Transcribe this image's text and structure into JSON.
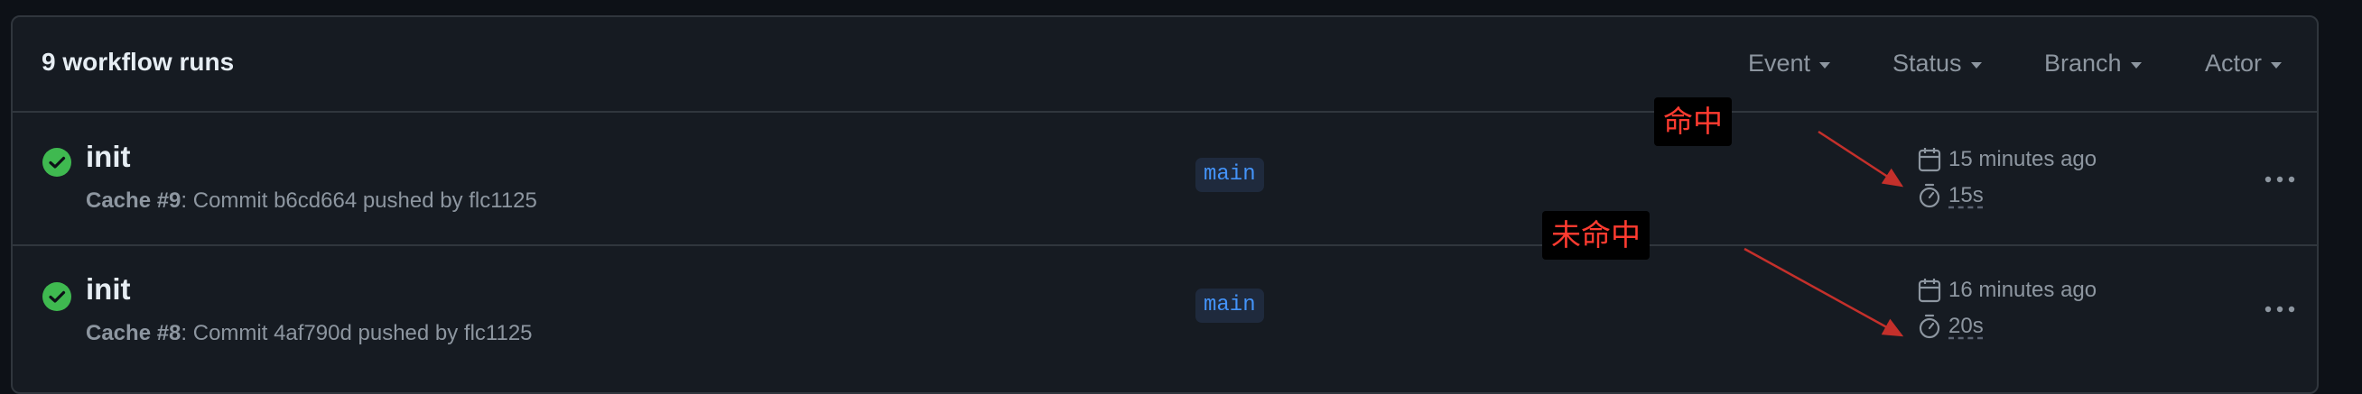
{
  "header": {
    "title": "9 workflow runs",
    "filters": [
      "Event",
      "Status",
      "Branch",
      "Actor"
    ]
  },
  "runs": [
    {
      "title": "init",
      "workflow": "Cache #9",
      "detail": ": Commit b6cd664 pushed by flc1125",
      "branch": "main",
      "time": "15 minutes ago",
      "duration": "15s",
      "status": "success"
    },
    {
      "title": "init",
      "workflow": "Cache #8",
      "detail": ": Commit 4af790d pushed by flc1125",
      "branch": "main",
      "time": "16 minutes ago",
      "duration": "20s",
      "status": "success"
    }
  ],
  "annotations": [
    {
      "text": "命中"
    },
    {
      "text": "未命中"
    }
  ],
  "colors": {
    "success": "#3fb950",
    "annotation": "#ff3b30",
    "link": "#4493f8"
  },
  "icons": [
    "check-circle-icon",
    "calendar-icon",
    "stopwatch-icon",
    "kebab-menu-icon",
    "caret-down-icon"
  ]
}
